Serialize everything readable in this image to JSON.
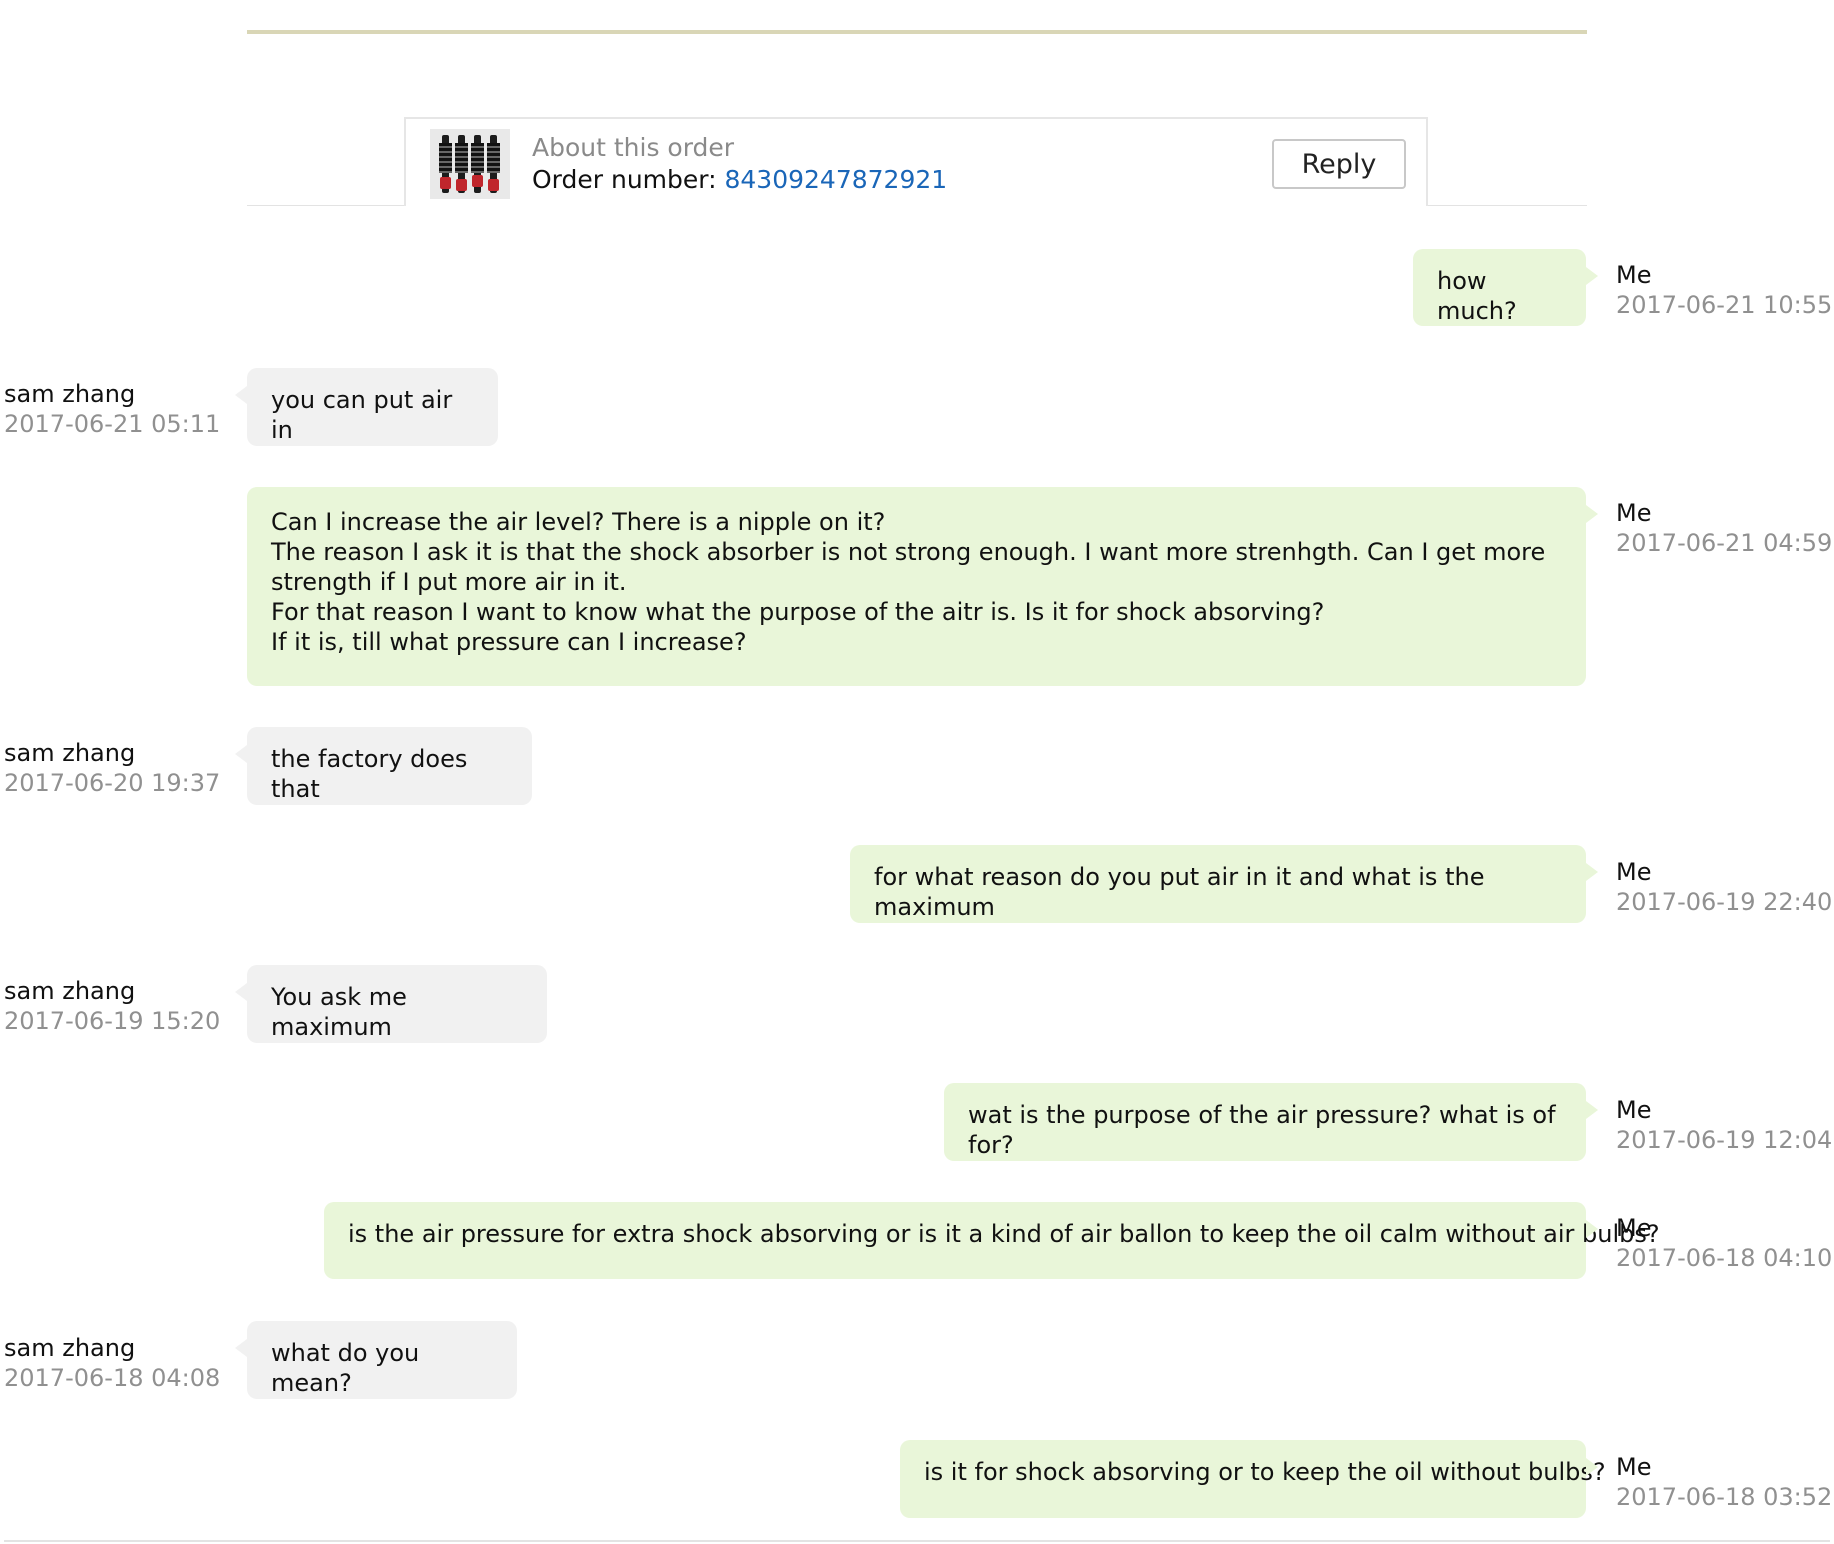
{
  "order": {
    "about_label": "About this order",
    "number_prefix": "Order number: ",
    "number": "84309247872921",
    "reply_label": "Reply"
  },
  "messages": [
    {
      "from": "me",
      "sender": "Me",
      "time": "2017-06-21 10:55",
      "text": "how much?"
    },
    {
      "from": "them",
      "sender": "sam zhang",
      "time": "2017-06-21 05:11",
      "text": "you can put air in"
    },
    {
      "from": "me",
      "sender": "Me",
      "time": "2017-06-21 04:59",
      "text": "Can I increase the air level? There is a nipple on it?\nThe reason I ask it is that the shock absorber is not strong enough. I want more strenhgth. Can I get more strength if I put more air in it.\nFor that reason I want to know what the purpose of the aitr is. Is it for shock absorving?\nIf it is, till what pressure can I increase?"
    },
    {
      "from": "them",
      "sender": "sam zhang",
      "time": "2017-06-20 19:37",
      "text": "the factory does that"
    },
    {
      "from": "me",
      "sender": "Me",
      "time": "2017-06-19 22:40",
      "text": "for what reason do you put air in it and what is the maximum"
    },
    {
      "from": "them",
      "sender": "sam zhang",
      "time": "2017-06-19 15:20",
      "text": "You ask me maximum"
    },
    {
      "from": "me",
      "sender": "Me",
      "time": "2017-06-19 12:04",
      "text": "wat is the purpose of the air pressure? what is of for?"
    },
    {
      "from": "me",
      "sender": "Me",
      "time": "2017-06-18 04:10",
      "text": "is the air pressure for extra shock absorving or is it a kind of air ballon to keep the oil calm without air bulbs?"
    },
    {
      "from": "them",
      "sender": "sam zhang",
      "time": "2017-06-18 04:08",
      "text": "what do you mean?"
    },
    {
      "from": "me",
      "sender": "Me",
      "time": "2017-06-18 03:52",
      "text": "is it for shock absorving or to keep the oil without bulbs?"
    }
  ],
  "colors": {
    "me_bubble": "#e9f6d9",
    "them_bubble": "#f1f1f1",
    "link": "#1a66b8",
    "top_rule": "#d9d6b6"
  },
  "icons": {
    "product_thumbnail": "shock-absorber-product-image"
  }
}
